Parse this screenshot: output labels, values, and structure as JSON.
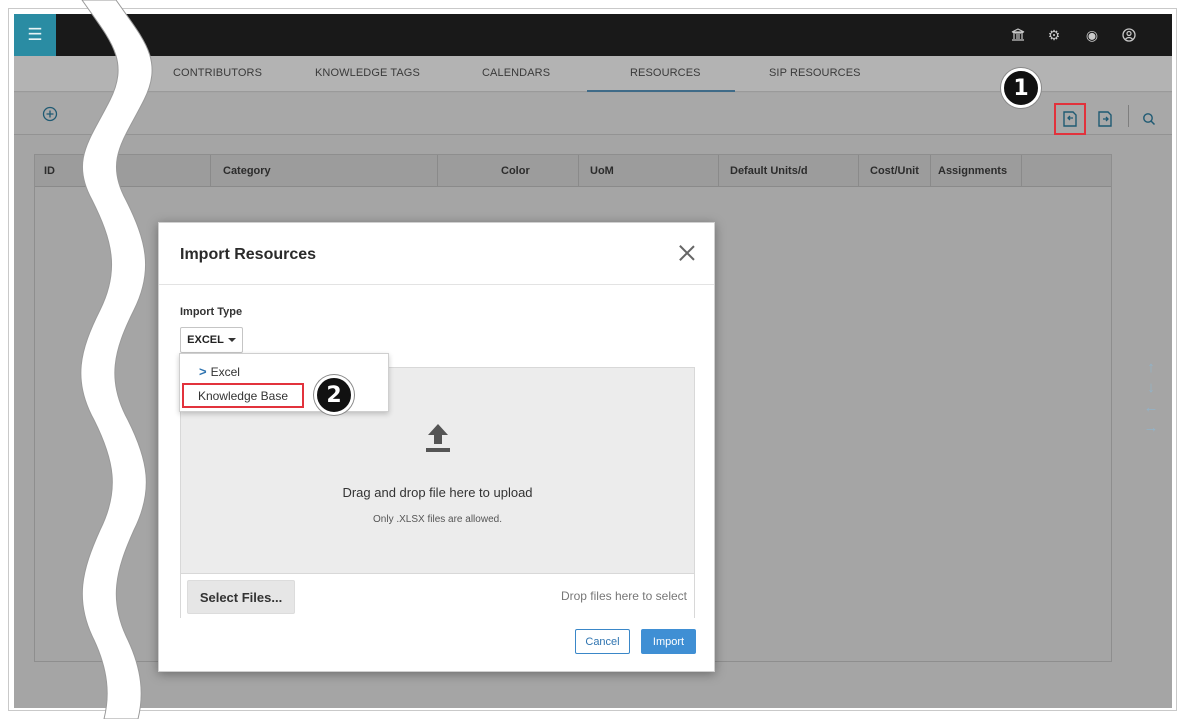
{
  "tabs": [
    {
      "label": "CONTRIBUTORS"
    },
    {
      "label": "KNOWLEDGE TAGS"
    },
    {
      "label": "CALENDARS"
    },
    {
      "label": "RESOURCES"
    },
    {
      "label": "SIP RESOURCES"
    }
  ],
  "active_tab": "RESOURCES",
  "grid": {
    "columns": [
      "ID",
      "Category",
      "Color",
      "UoM",
      "Default Units/d",
      "Cost/Unit",
      "Assignments"
    ]
  },
  "callouts": {
    "one": "1",
    "two": "2"
  },
  "modal": {
    "title": "Import Resources",
    "import_type_label": "Import Type",
    "selected_type": "EXCEL",
    "type_options": [
      "Excel",
      "Knowledge Base"
    ],
    "dropzone_main": "Drag and drop file here to upload",
    "dropzone_sub": "Only .XLSX files are allowed.",
    "select_files": "Select Files...",
    "drop_hint": "Drop files here to select",
    "cancel": "Cancel",
    "import": "Import"
  },
  "nav_arrows": [
    "↑",
    "↓",
    "←",
    "→"
  ],
  "colors": {
    "topbar": "#191919",
    "menu_button": "#2a8ca3",
    "accent": "#3f8fd4",
    "highlight": "#e2323c"
  }
}
